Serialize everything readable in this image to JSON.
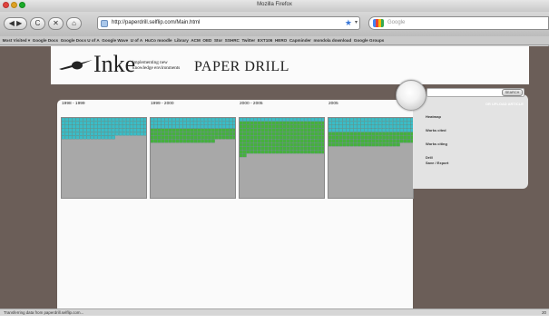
{
  "window": {
    "title": "Mozilla Firefox"
  },
  "toolbar": {
    "back": "◀",
    "forward": "▶",
    "reload": "C",
    "home": "⌂",
    "url": "http://paperdrill.selflip.com/Main.html",
    "search_placeholder": "Google"
  },
  "bookmarks": [
    "Most Visited ▾",
    "Google Docs",
    "Google Docs U of A",
    "Google Wave",
    "U of A",
    "HuCo moodle",
    "Library",
    "ACM",
    "OED",
    "Stor",
    "SSHRC",
    "Twitter",
    "EXT106",
    "HERO",
    "Capminder",
    "mondola download",
    "Google Groups"
  ],
  "header": {
    "logo_word": "Inke",
    "tagline_1": "implementing new",
    "tagline_2": "knowledge environments",
    "app_title": "PAPER DRILL"
  },
  "heatmap_columns": [
    {
      "label": "1998 - 1999",
      "teal_rows": 5,
      "green_rows": 0,
      "partial_teal_cols": 15
    },
    {
      "label": "1999 - 2000",
      "teal_rows": 3,
      "green_rows": 3,
      "partial_teal_cols": 18
    },
    {
      "label": "2000 - 2005",
      "teal_rows": 1,
      "green_rows": 9,
      "partial_teal_cols": 2
    },
    {
      "label": "2005",
      "teal_rows": 4,
      "green_rows": 3,
      "partial_teal_cols": 20
    }
  ],
  "side_panel": {
    "search_button": "SEARCH",
    "upload_link": "OR UPLOAD ARTICLE",
    "items": [
      "Heatmap",
      "Works cited",
      "Works citing",
      "Drill",
      "Save / Export"
    ]
  },
  "status": {
    "text": "Transferring data from paperdrill.selflip.com...",
    "right": "20"
  },
  "colors": {
    "teal": "#3bbcc7",
    "green": "#46b13c",
    "grey_empty": "#a8a8a8",
    "page_background": "#6b5e58"
  }
}
